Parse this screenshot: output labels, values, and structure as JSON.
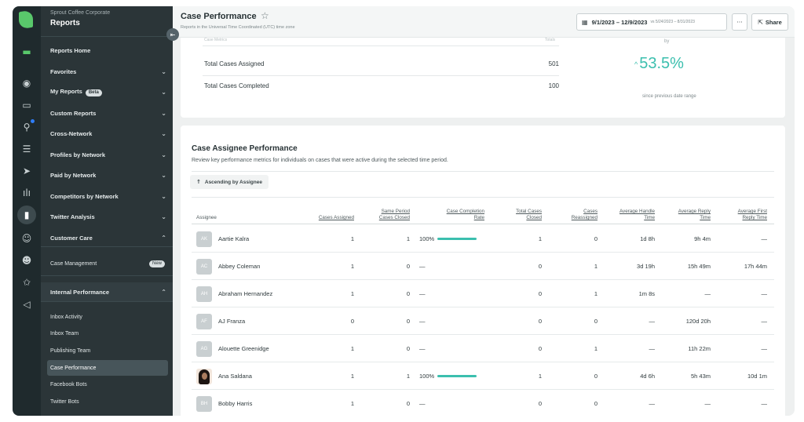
{
  "colors": {
    "accent": "#3bbfae",
    "nav_bg": "#2b3538",
    "rail_bg": "#1f2a2d",
    "brand": "#59c86b"
  },
  "rail": {
    "icons": [
      "sprout-logo-icon",
      "folder-icon",
      "compass-icon",
      "inbox-icon",
      "pin-icon",
      "list-icon",
      "send-icon",
      "audio-wave-icon",
      "bar-chart-icon",
      "people-icon",
      "smile-icon",
      "star-badge-icon",
      "megaphone-icon"
    ]
  },
  "nav": {
    "org": "Sprout Coffee Corporate",
    "title": "Reports",
    "items": [
      {
        "label": "Reports Home"
      },
      {
        "label": "Favorites"
      },
      {
        "label": "My Reports",
        "badge": "Beta"
      },
      {
        "label": "Custom Reports"
      },
      {
        "label": "Cross-Network"
      },
      {
        "label": "Profiles by Network"
      },
      {
        "label": "Paid by Network"
      },
      {
        "label": "Competitors by Network"
      },
      {
        "label": "Twitter Analysis"
      },
      {
        "label": "Customer Care"
      }
    ],
    "case_management": {
      "label": "Case Management",
      "badge": "New"
    },
    "internal_performance": {
      "label": "Internal Performance"
    },
    "sub_items": [
      {
        "label": "Inbox Activity"
      },
      {
        "label": "Inbox Team"
      },
      {
        "label": "Publishing Team"
      },
      {
        "label": "Case Performance"
      },
      {
        "label": "Facebook Bots"
      },
      {
        "label": "Twitter Bots"
      }
    ]
  },
  "header": {
    "title": "Case Performance",
    "timezone_note": "Reports in the Universal Time Coordinated (UTC) time zone",
    "date_range": "9/1/2023 – 12/9/2023",
    "compare_range": "vs 5/24/2023 – 8/31/2023",
    "more_label": "···",
    "share_label": "Share"
  },
  "summary": {
    "col_left_header": "Case Metrics",
    "col_right_header": "Totals",
    "rows": [
      {
        "label": "Total Cases Assigned",
        "value": "501"
      },
      {
        "label": "Total Cases Completed",
        "value": "100"
      }
    ],
    "by_label": "by",
    "change": "53.5%",
    "since_label": "since previous date range"
  },
  "assignee": {
    "title": "Case Assignee Performance",
    "description": "Review key performance metrics for individuals on cases that were active during the selected time period.",
    "sort_label": "Ascending by Assignee",
    "columns": [
      {
        "l1": "",
        "l2": "Assignee"
      },
      {
        "l1": "",
        "l2": "Cases Assigned"
      },
      {
        "l1": "Same Period",
        "l2": "Cases Closed"
      },
      {
        "l1": "Case Completion",
        "l2": "Rate"
      },
      {
        "l1": "Total Cases",
        "l2": "Closed"
      },
      {
        "l1": "Cases",
        "l2": "Reassigned"
      },
      {
        "l1": "Average Handle",
        "l2": "Time"
      },
      {
        "l1": "Average Reply",
        "l2": "Time"
      },
      {
        "l1": "Average First",
        "l2": "Reply Time"
      }
    ],
    "rows": [
      {
        "initials": "AK",
        "name": "Aartie Kalra",
        "assigned": "1",
        "closed": "1",
        "rate": "100%",
        "rate_value": 1,
        "total_closed": "1",
        "reassigned": "0",
        "handle": "1d 8h",
        "reply": "9h 4m",
        "first_reply": "—"
      },
      {
        "initials": "AC",
        "name": "Abbey Coleman",
        "assigned": "1",
        "closed": "0",
        "rate": "—",
        "rate_value": 0,
        "total_closed": "0",
        "reassigned": "1",
        "handle": "3d 19h",
        "reply": "15h 49m",
        "first_reply": "17h 44m"
      },
      {
        "initials": "AH",
        "name": "Abraham Hernandez",
        "assigned": "1",
        "closed": "0",
        "rate": "—",
        "rate_value": 0,
        "total_closed": "0",
        "reassigned": "1",
        "handle": "1m 8s",
        "reply": "—",
        "first_reply": "—"
      },
      {
        "initials": "AF",
        "name": "AJ Franza",
        "assigned": "0",
        "closed": "0",
        "rate": "—",
        "rate_value": 0,
        "total_closed": "0",
        "reassigned": "0",
        "handle": "—",
        "reply": "120d 20h",
        "first_reply": "—"
      },
      {
        "initials": "AG",
        "name": "Alouette Greenidge",
        "assigned": "1",
        "closed": "0",
        "rate": "—",
        "rate_value": 0,
        "total_closed": "0",
        "reassigned": "1",
        "handle": "—",
        "reply": "11h 22m",
        "first_reply": "—"
      },
      {
        "initials": "",
        "name": "Ana Saldana",
        "assigned": "1",
        "closed": "1",
        "rate": "100%",
        "rate_value": 1,
        "total_closed": "1",
        "reassigned": "0",
        "handle": "4d 6h",
        "reply": "5h 43m",
        "first_reply": "10d 1m"
      },
      {
        "initials": "BH",
        "name": "Bobby Harris",
        "assigned": "1",
        "closed": "0",
        "rate": "—",
        "rate_value": 0,
        "total_closed": "0",
        "reassigned": "0",
        "handle": "—",
        "reply": "—",
        "first_reply": "—"
      }
    ]
  }
}
